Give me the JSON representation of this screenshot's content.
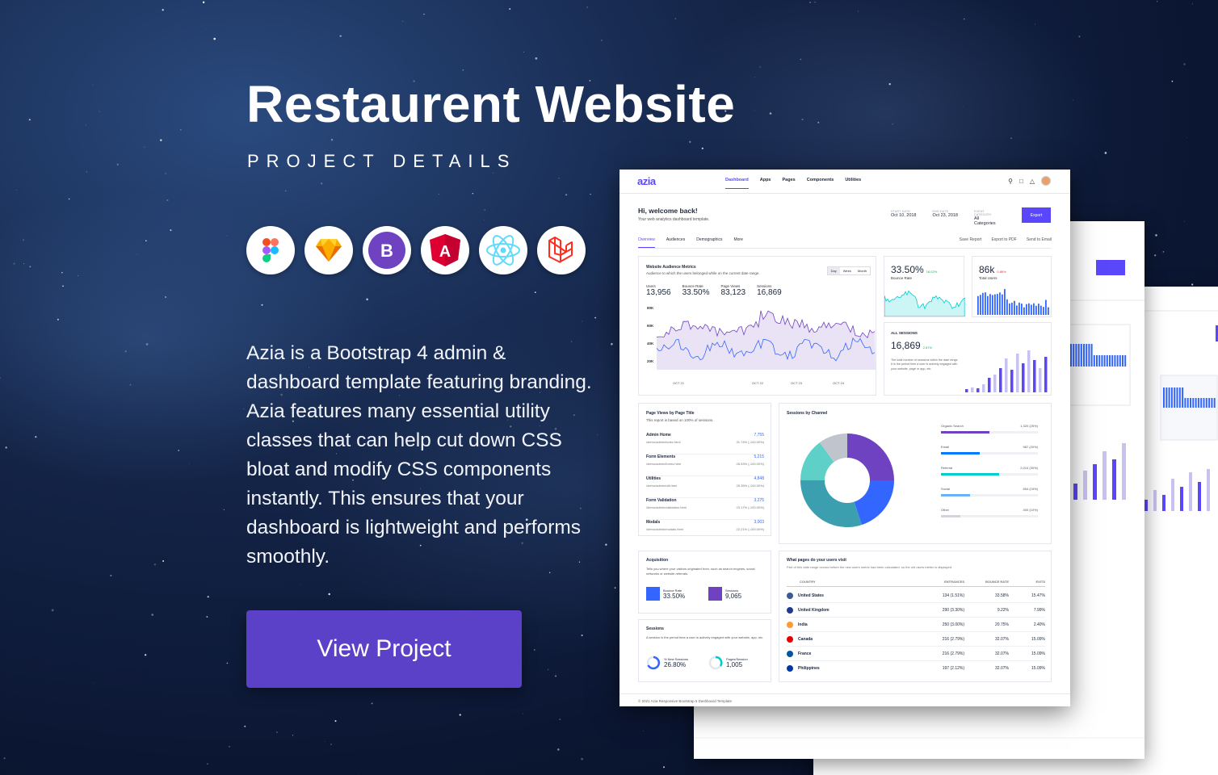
{
  "hero": {
    "title": "Restaurent Website",
    "subtitle": "PROJECT DETAILS",
    "description": "Azia is a Bootstrap 4 admin & dashboard template featuring branding. Azia features many essential utility classes that can help cut down CSS bloat and modify CSS components instantly. This ensures that your dashboard is lightweight and performs smoothly.",
    "cta_label": "View Project",
    "tech_icons": [
      "figma-icon",
      "sketch-icon",
      "bootstrap-icon",
      "angular-icon",
      "react-icon",
      "laravel-icon"
    ],
    "accent": "#5b40c8"
  },
  "dashboard": {
    "logo": "azia",
    "menu": [
      "Dashboard",
      "Apps",
      "Pages",
      "Components",
      "Utilities"
    ],
    "greeting": "Hi, welcome back!",
    "greeting_sub": "Your web analytics dashboard template.",
    "start_date_label": "START DATE",
    "start_date": "Oct 10, 2018",
    "end_date_label": "END DATE",
    "end_date": "Oct 23, 2018",
    "event_category_label": "EVENT CATEGORY",
    "event_category": "All Categories",
    "export_label": "Export",
    "tabs": [
      "Overview",
      "Audiences",
      "Demographics",
      "More"
    ],
    "actions": [
      "Save Report",
      "Export to PDF",
      "Send to Email"
    ],
    "audience": {
      "title": "Website Audience Metrics",
      "subtitle": "Audience to which the users belonged while on the current date range.",
      "ranges": [
        "Day",
        "Week",
        "Month"
      ],
      "metrics": [
        {
          "label": "Users",
          "value": "13,956"
        },
        {
          "label": "Bounce Rate",
          "value": "33.50%"
        },
        {
          "label": "Page Views",
          "value": "83,123"
        },
        {
          "label": "Sessions",
          "value": "16,869"
        }
      ],
      "y_ticks": [
        "60K",
        "40K",
        "20K"
      ],
      "y_top": "80K",
      "x_ticks": [
        "OCT 21",
        "OCT 22",
        "OCT 23",
        "OCT 24"
      ]
    },
    "bounce": {
      "value": "33.50%",
      "change": "18.02%",
      "label": "Bounce Rate"
    },
    "users": {
      "value": "86k",
      "change": "0.86%",
      "label": "Total Users"
    },
    "all_sessions": {
      "label": "ALL SESSIONS",
      "value": "16,869",
      "change": "2.87%",
      "desc": "The total number of sessions within the date range. It is the period time a user is actively engaged with your website, page or app, etc."
    },
    "page_views": {
      "title": "Page Views by Page Title",
      "subtitle": "This report is based on 100% of sessions.",
      "rows": [
        {
          "title": "Admin Home",
          "url": "/demo/admin/index.html",
          "value": "7,755",
          "pct": "31.74% (-100.00%)"
        },
        {
          "title": "Form Elements",
          "url": "/demo/admin/forms.html",
          "value": "5,215",
          "pct": "28.53% (-100.00%)"
        },
        {
          "title": "Utilities",
          "url": "/demo/admin/util.html",
          "value": "4,848",
          "pct": "25.35% (-100.00%)"
        },
        {
          "title": "Form Validation",
          "url": "/demo/admin/validation.html",
          "value": "3,275",
          "pct": "23.17% (-100.00%)"
        },
        {
          "title": "Modals",
          "url": "/demo/admin/modals.html",
          "value": "3,003",
          "pct": "22.21% (-100.00%)"
        }
      ]
    },
    "channels": {
      "title": "Sessions by Channel",
      "rows": [
        {
          "name": "Organic Search",
          "value": "1,320 (25%)",
          "pct": 25,
          "color": "#6f42c1"
        },
        {
          "name": "Email",
          "value": "987 (20%)",
          "pct": 20,
          "color": "#007bff"
        },
        {
          "name": "Referral",
          "value": "2,010 (30%)",
          "pct": 30,
          "color": "#00cccc"
        },
        {
          "name": "Social",
          "value": "654 (15%)",
          "pct": 15,
          "color": "#69b2f8"
        },
        {
          "name": "Other",
          "value": "400 (10%)",
          "pct": 10,
          "color": "#d1d5db"
        }
      ]
    },
    "acquisition": {
      "title": "Acquisition",
      "subtitle": "Tells you where your visitors originated from, such as search engines, social networks or website referrals.",
      "bounce_label": "Bounce Rate",
      "bounce_value": "33.50%",
      "sessions_label": "Sessions",
      "sessions_value": "9,065"
    },
    "sessions_card": {
      "title": "Sessions",
      "subtitle": "A session is the period time a user is actively engaged with your website, app, etc.",
      "new_label": "% New Sessions",
      "new_value": "26.80%",
      "pps_label": "Pages/Session",
      "pps_value": "1,005"
    },
    "visits": {
      "title": "What pages do your users visit",
      "subtitle": "Part of this date range occurs before the new users metric had been calculated, so the old users metric is displayed.",
      "headers": [
        "COUNTRY",
        "ENTRANCES",
        "BOUNCE RATE",
        "EXITS"
      ],
      "rows": [
        {
          "country": "United States",
          "entrances": "134 (1.51%)",
          "bounce": "33.58%",
          "exits": "15.47%",
          "flag": "#3b5998"
        },
        {
          "country": "United Kingdom",
          "entrances": "290 (3.30%)",
          "bounce": "9.22%",
          "exits": "7.99%",
          "flag": "#1f3a93"
        },
        {
          "country": "India",
          "entrances": "250 (3.00%)",
          "bounce": "20.75%",
          "exits": "2.40%",
          "flag": "#ff9933"
        },
        {
          "country": "Canada",
          "entrances": "216 (2.79%)",
          "bounce": "32.07%",
          "exits": "15.09%",
          "flag": "#e60000"
        },
        {
          "country": "France",
          "entrances": "216 (2.79%)",
          "bounce": "32.07%",
          "exits": "15.09%",
          "flag": "#0055a4"
        },
        {
          "country": "Philippines",
          "entrances": "197 (2.12%)",
          "bounce": "32.07%",
          "exits": "15.09%",
          "flag": "#0038a8"
        }
      ]
    },
    "footer": "© 2021 Azia Responsive Bootstrap 5 Dashboard Template"
  }
}
